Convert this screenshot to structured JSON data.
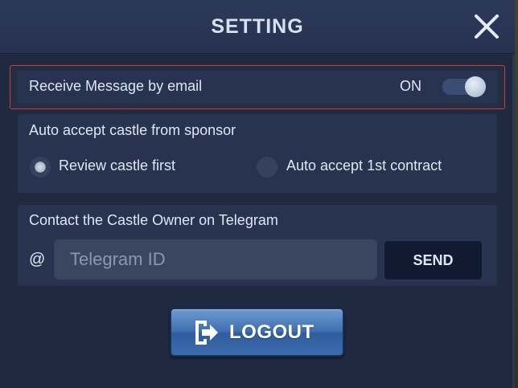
{
  "header": {
    "title": "SETTING",
    "close_icon": "close-icon"
  },
  "email": {
    "label": "Receive Message by email",
    "toggle_state": "ON",
    "enabled": true
  },
  "auto_accept": {
    "label": "Auto accept castle from sponsor",
    "options": [
      {
        "label": "Review castle first",
        "selected": true
      },
      {
        "label": "Auto accept 1st contract",
        "selected": false
      }
    ]
  },
  "telegram": {
    "label": "Contact the Castle Owner on Telegram",
    "prefix": "@",
    "placeholder": "Telegram ID",
    "value": "",
    "send_label": "SEND"
  },
  "logout": {
    "label": "LOGOUT",
    "icon": "logout-door-icon"
  },
  "colors": {
    "panel": "#1f2940",
    "highlight_border": "#d33a3a",
    "logout_button": "#3f6fb1",
    "send_button": "#101a30"
  }
}
